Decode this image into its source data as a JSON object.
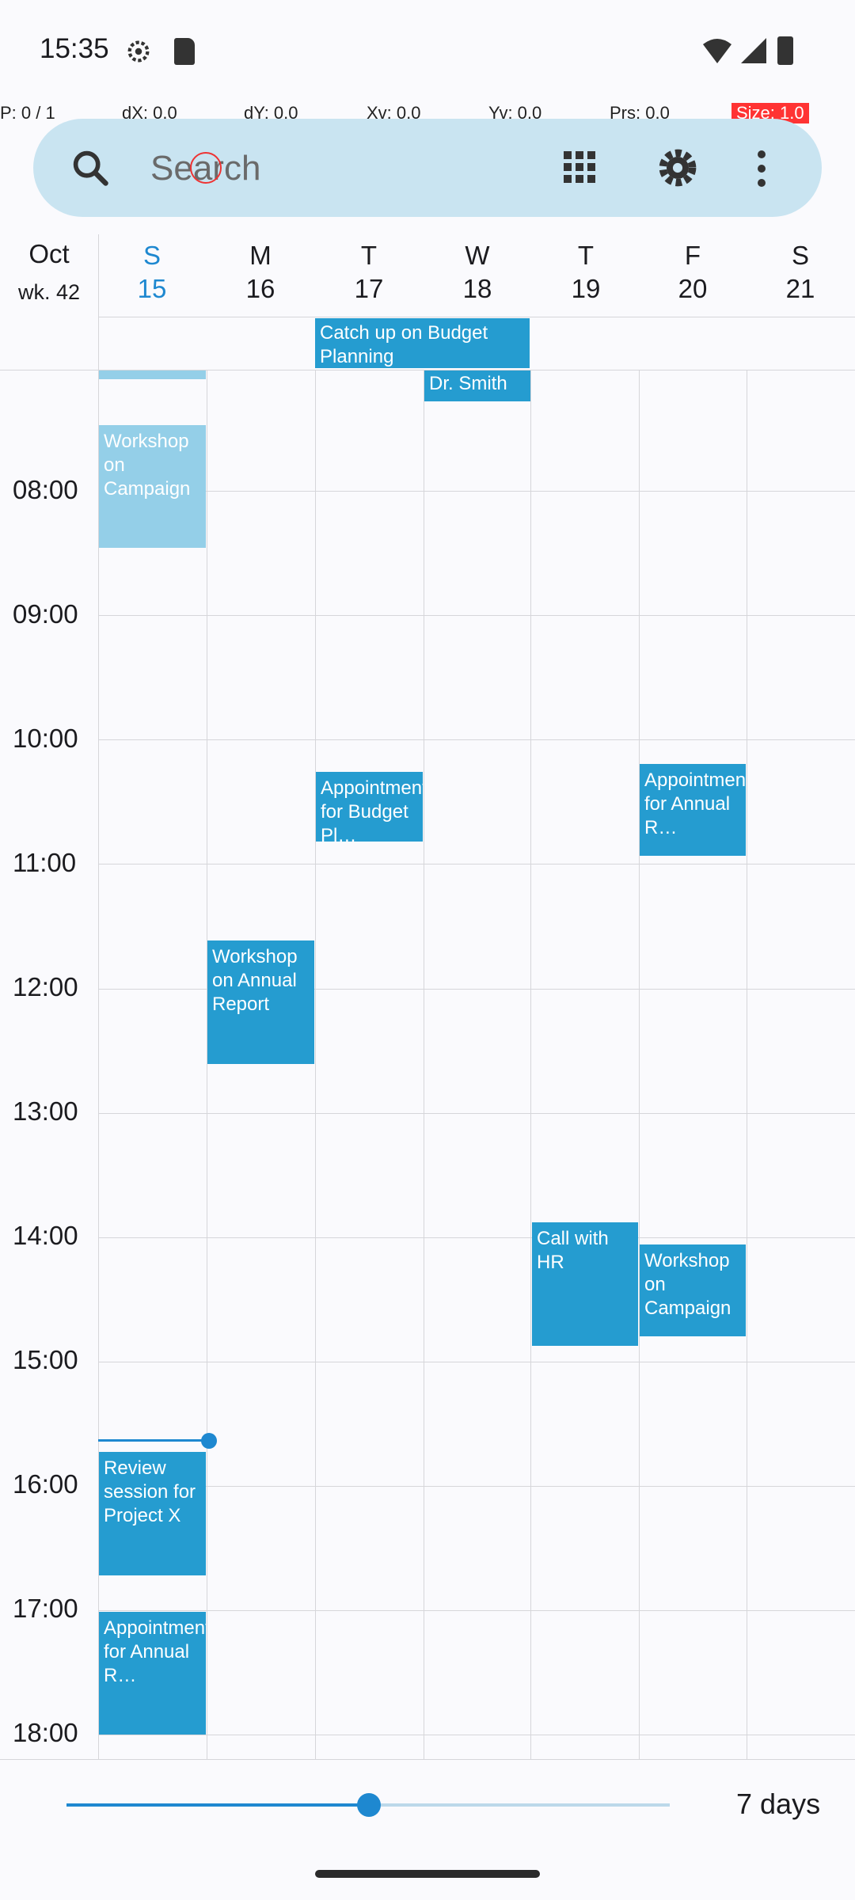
{
  "status_bar": {
    "time": "15:35"
  },
  "debug": {
    "p": "P: 0 / 1",
    "dx": "dX: 0.0",
    "dy": "dY: 0.0",
    "xv": "Xv: 0.0",
    "yv": "Yv: 0.0",
    "prs": "Prs: 0.0",
    "size": "Size: 1.0"
  },
  "search": {
    "placeholder": "Search"
  },
  "header": {
    "month": "Oct",
    "week": "wk. 42"
  },
  "days": [
    {
      "letter": "S",
      "num": "15"
    },
    {
      "letter": "M",
      "num": "16"
    },
    {
      "letter": "T",
      "num": "17"
    },
    {
      "letter": "W",
      "num": "18"
    },
    {
      "letter": "T",
      "num": "19"
    },
    {
      "letter": "F",
      "num": "20"
    },
    {
      "letter": "S",
      "num": "21"
    }
  ],
  "hours": [
    "08:00",
    "09:00",
    "10:00",
    "11:00",
    "12:00",
    "13:00",
    "14:00",
    "15:00",
    "16:00",
    "17:00",
    "18:00"
  ],
  "events": {
    "all_day": "Catch up on Budget Planning",
    "wed_top": "Dr. Smith",
    "sun_workshop": "Workshop on Campaign",
    "tue_appt": "Appointment for Budget Pl…",
    "fri_appt": "Appointment for Annual R…",
    "mon_workshop": "Workshop on Annual Report",
    "thu_call": "Call with HR",
    "fri_workshop": "Workshop on Campaign",
    "sun_review": "Review session for Project X",
    "sun_appt": "Appointment for Annual R…"
  },
  "bottom": {
    "days_label": "7 days",
    "zoom_fraction": 0.5
  },
  "colors": {
    "event": "#259CD0",
    "accent": "#1E88D0",
    "searchbar": "#C9E4F1"
  }
}
